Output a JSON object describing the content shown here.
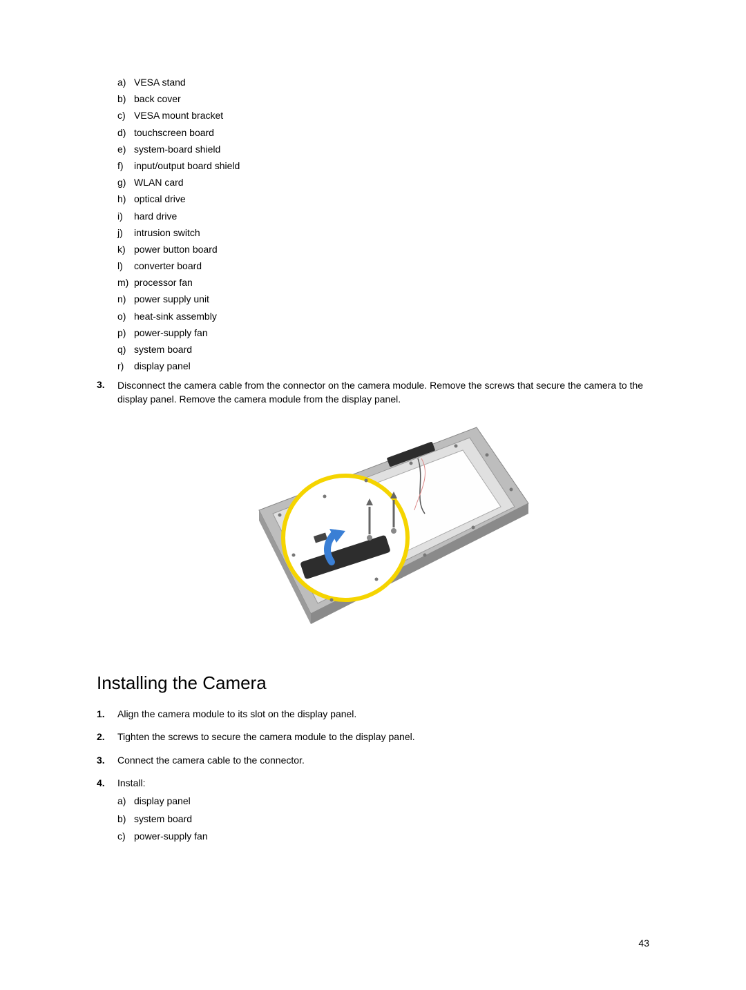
{
  "removal_sublist": [
    {
      "marker": "a)",
      "text": "VESA stand"
    },
    {
      "marker": "b)",
      "text": "back cover"
    },
    {
      "marker": "c)",
      "text": "VESA mount bracket"
    },
    {
      "marker": "d)",
      "text": "touchscreen board"
    },
    {
      "marker": "e)",
      "text": "system-board shield"
    },
    {
      "marker": "f)",
      "text": "input/output board shield"
    },
    {
      "marker": "g)",
      "text": "WLAN card"
    },
    {
      "marker": "h)",
      "text": "optical drive"
    },
    {
      "marker": "i)",
      "text": "hard drive"
    },
    {
      "marker": "j)",
      "text": "intrusion switch"
    },
    {
      "marker": "k)",
      "text": "power button board"
    },
    {
      "marker": "l)",
      "text": "converter board"
    },
    {
      "marker": "m)",
      "text": "processor fan"
    },
    {
      "marker": "n)",
      "text": "power supply unit"
    },
    {
      "marker": "o)",
      "text": "heat-sink assembly"
    },
    {
      "marker": "p)",
      "text": "power-supply fan"
    },
    {
      "marker": "q)",
      "text": "system board"
    },
    {
      "marker": "r)",
      "text": "display panel"
    }
  ],
  "step3": {
    "num": "3.",
    "text": "Disconnect the camera cable from the connector on the camera module. Remove the screws that secure the camera to the display panel. Remove the camera module from the display panel."
  },
  "heading": "Installing the Camera",
  "install_steps": [
    {
      "num": "1.",
      "text": "Align the camera module to its slot on the display panel."
    },
    {
      "num": "2.",
      "text": "Tighten the screws to secure the camera module to the display panel."
    },
    {
      "num": "3.",
      "text": "Connect the camera cable to the connector."
    },
    {
      "num": "4.",
      "text": "Install:"
    }
  ],
  "install_sublist": [
    {
      "marker": "a)",
      "text": "display panel"
    },
    {
      "marker": "b)",
      "text": "system board"
    },
    {
      "marker": "c)",
      "text": "power-supply fan"
    }
  ],
  "page_number": "43"
}
